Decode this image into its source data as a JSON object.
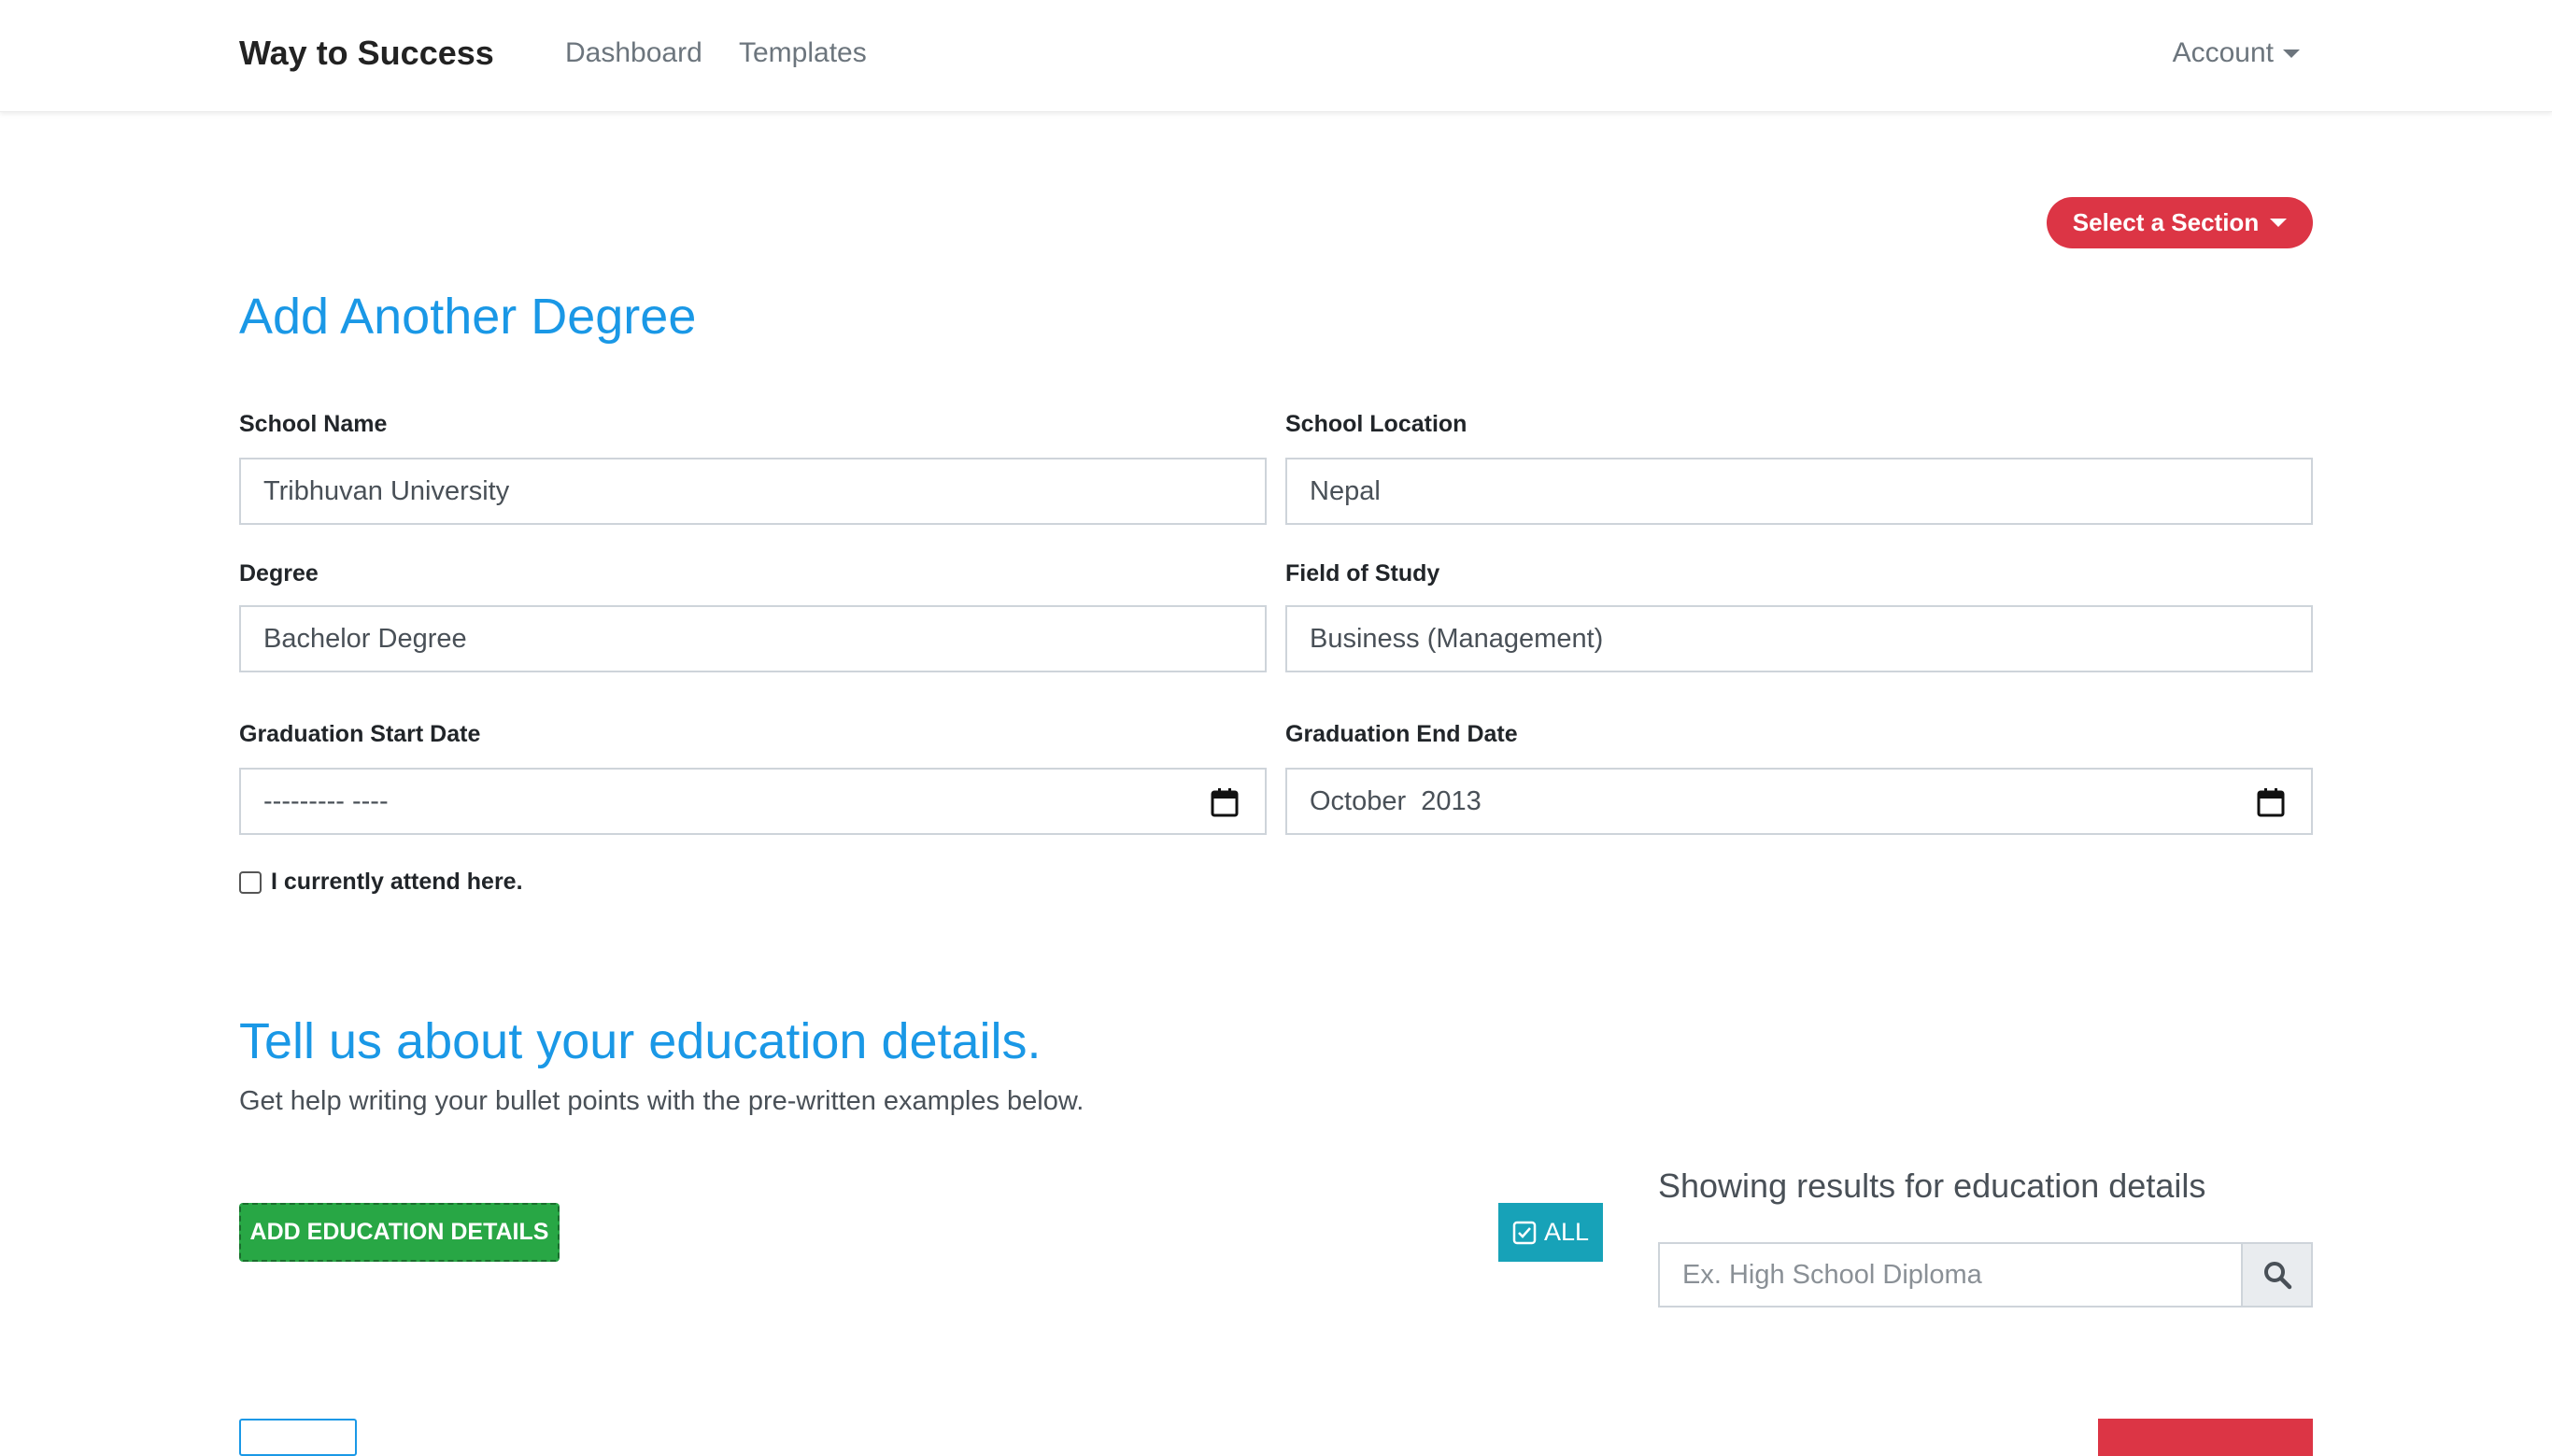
{
  "navbar": {
    "brand": "Way to Success",
    "links": [
      "Dashboard",
      "Templates"
    ],
    "account": "Account"
  },
  "section_button": "Select a Section",
  "degree_form": {
    "title": "Add Another Degree",
    "school_name": {
      "label": "School Name",
      "value": "Tribhuvan University"
    },
    "school_location": {
      "label": "School Location",
      "value": "Nepal"
    },
    "degree": {
      "label": "Degree",
      "value": "Bachelor Degree"
    },
    "field_of_study": {
      "label": "Field of Study",
      "value": "Business (Management)"
    },
    "grad_start": {
      "label": "Graduation Start Date",
      "value": "--------- ----"
    },
    "grad_end": {
      "label": "Graduation End Date",
      "value": "October  2013"
    },
    "attending": {
      "label": "I currently attend here.",
      "checked": false
    }
  },
  "details": {
    "title": "Tell us about your education details.",
    "subtitle": "Get help writing your bullet points with the pre-written examples below.",
    "add_button": "ADD EDUCATION DETAILS",
    "all_button": "ALL",
    "results_heading": "Showing results for education details",
    "search_placeholder": "Ex. High School Diploma"
  },
  "icons": {
    "calendar": "calendar-icon",
    "search": "search-icon",
    "check_square": "check-square-icon",
    "caret": "caret-down-icon"
  },
  "colors": {
    "accent_blue": "#1a98e6",
    "danger": "#dc3545",
    "success": "#28a745",
    "info": "#17a2b8"
  }
}
